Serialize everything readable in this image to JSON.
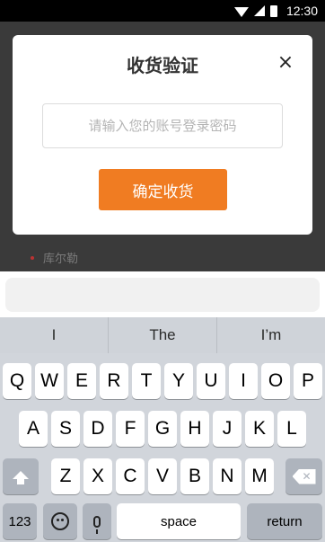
{
  "status_bar": {
    "time": "12:30"
  },
  "background": {
    "list_item": "库尔勒"
  },
  "dialog": {
    "title": "收货验证",
    "close_glyph": "×",
    "password_placeholder": "请输入您的账号登录密码",
    "confirm_label": "确定收货",
    "accent_color": "#f07c22"
  },
  "keyboard": {
    "suggestions": [
      "I",
      "The",
      "I’m"
    ],
    "row1": [
      "Q",
      "W",
      "E",
      "R",
      "T",
      "Y",
      "U",
      "I",
      "O",
      "P"
    ],
    "row2": [
      "A",
      "S",
      "D",
      "F",
      "G",
      "H",
      "J",
      "K",
      "L"
    ],
    "row3": [
      "Z",
      "X",
      "C",
      "V",
      "B",
      "N",
      "M"
    ],
    "bottom": {
      "numbers": "123",
      "space": "space",
      "return": "return"
    },
    "icons": [
      "shift-icon",
      "backspace-icon",
      "emoji-icon",
      "microphone-icon"
    ]
  }
}
